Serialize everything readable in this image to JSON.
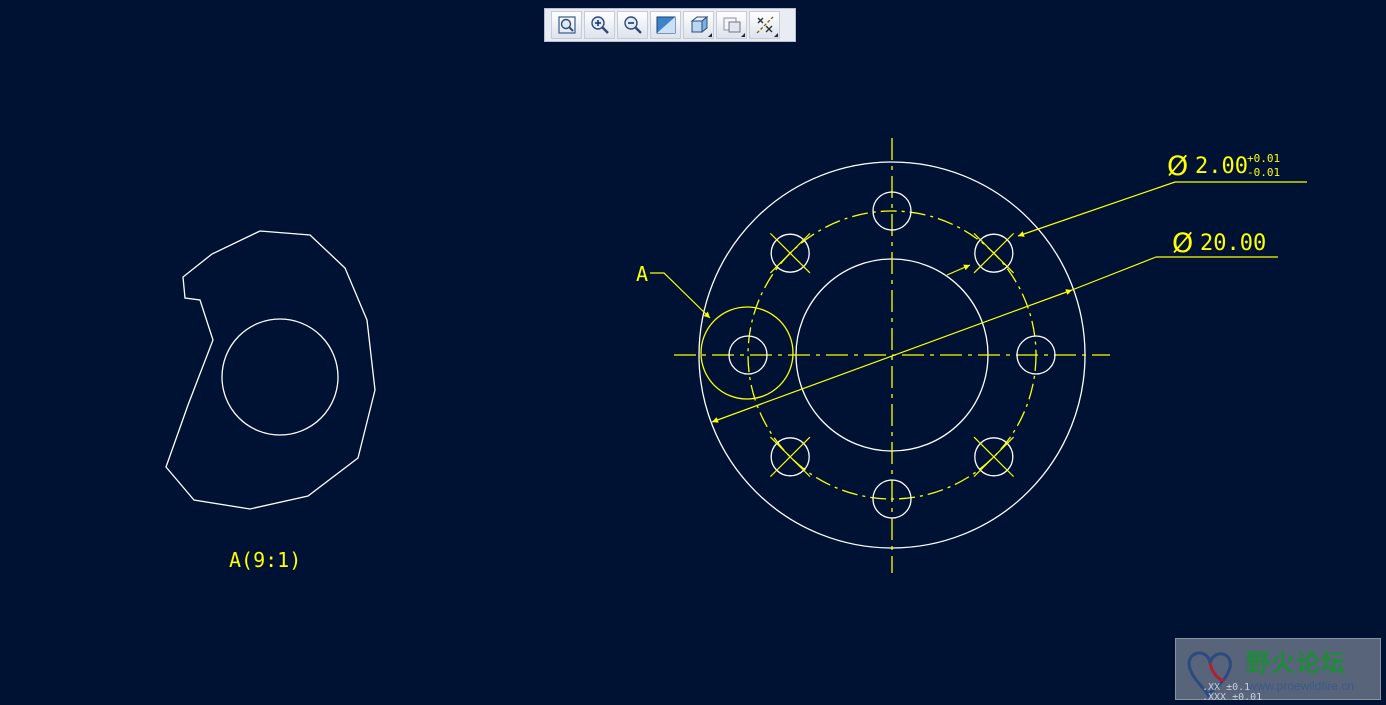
{
  "toolbar": {
    "buttons": [
      {
        "name": "zoom-refit",
        "icon": "zoom-refit-icon",
        "flyout": false
      },
      {
        "name": "zoom-in",
        "icon": "zoom-in-icon",
        "flyout": false
      },
      {
        "name": "zoom-out",
        "icon": "zoom-out-icon",
        "flyout": false
      },
      {
        "name": "repaint",
        "icon": "repaint-icon",
        "flyout": false
      },
      {
        "name": "display-style",
        "icon": "display-style-icon",
        "flyout": true
      },
      {
        "name": "saved-orientations",
        "icon": "saved-orientations-icon",
        "flyout": true
      },
      {
        "name": "datum-display",
        "icon": "datum-display-icon",
        "flyout": true
      }
    ]
  },
  "drawing": {
    "colors": {
      "background": "#001233",
      "geometry": "#ffffff",
      "annotation": "#ffff00"
    },
    "detail_view_label": "A(9:1)",
    "detail_callout": "A",
    "dim_hole": {
      "symbol": "Ø",
      "value": "2.00",
      "tol_upper": "+0.01",
      "tol_lower": "-0.01"
    },
    "dim_pcd": {
      "symbol": "Ø",
      "value": "20.00"
    },
    "hole_count": 8
  },
  "watermark": {
    "title": "野火论坛",
    "url": "www.proewildfire.cn",
    "faint_line1": ".XX  ±0.1",
    "faint_line2": ".XXX ±0.01"
  }
}
